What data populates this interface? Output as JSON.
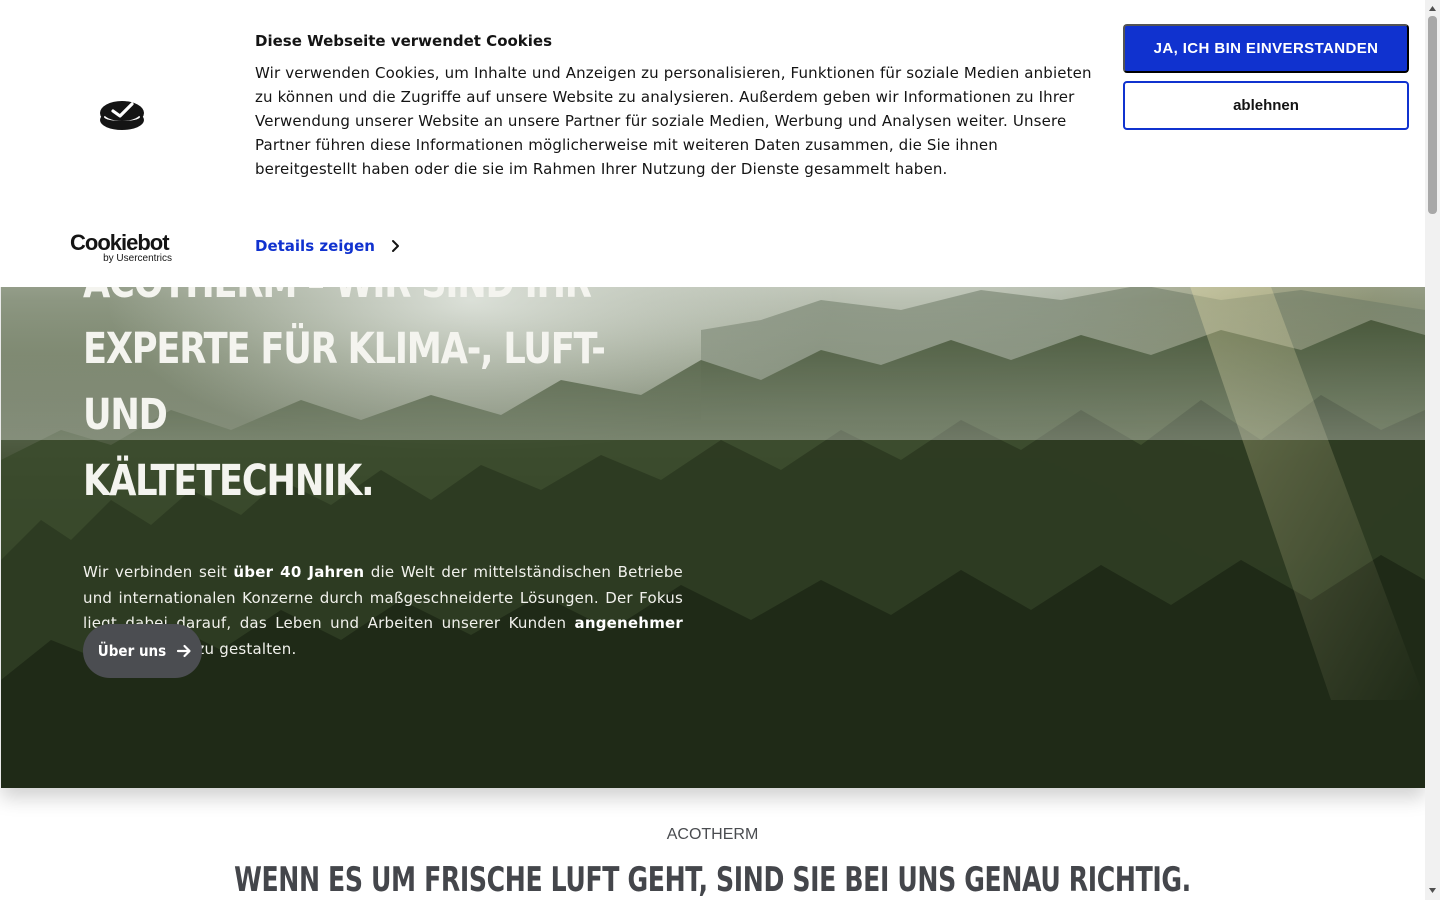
{
  "cookie_banner": {
    "title": "Diese Webseite verwendet Cookies",
    "text": "Wir verwenden Cookies, um Inhalte und Anzeigen zu personalisieren, Funktionen für soziale Medien anbieten zu können und die Zugriffe auf unsere Website zu analysieren. Außerdem geben wir Informationen zu Ihrer Verwendung unserer Website an unsere Partner für soziale Medien, Werbung und Analysen weiter. Unsere Partner führen diese Informationen möglicherweise mit weiteren Daten zusammen, die Sie ihnen bereitgestellt haben oder die sie im Rahmen Ihrer Nutzung der Dienste gesammelt haben.",
    "details_label": "Details zeigen",
    "accept_label": "JA, ICH BIN EINVERSTANDEN",
    "decline_label": "ablehnen",
    "brand_name": "Cookiebot",
    "brand_by": "by Usercentrics",
    "accent_color": "#1032cf"
  },
  "hero": {
    "title_line_1": "Acotherm – Wir sind Ihr",
    "title_line_2": "Experte für Klima-, Luft- und",
    "title_line_3": "Kältetechnik.",
    "text_1": "Wir verbinden seit ",
    "text_bold_1": "über 40 Jahren",
    "text_2": " die Welt der mittelständischen Betriebe und internationalen Konzerne durch maßgeschneiderte Lösungen. Der Fokus liegt dabei darauf, das Leben und Arbeiten unserer Kunden ",
    "text_bold_2": "angenehmer und sicherer",
    "text_3": " zu gestalten.",
    "button_label": "Über uns"
  },
  "section": {
    "label": "ACOTHERM",
    "heading": "WENN ES UM FRISCHE LUFT GEHT, SIND SIE BEI UNS GENAU RICHTIG."
  }
}
